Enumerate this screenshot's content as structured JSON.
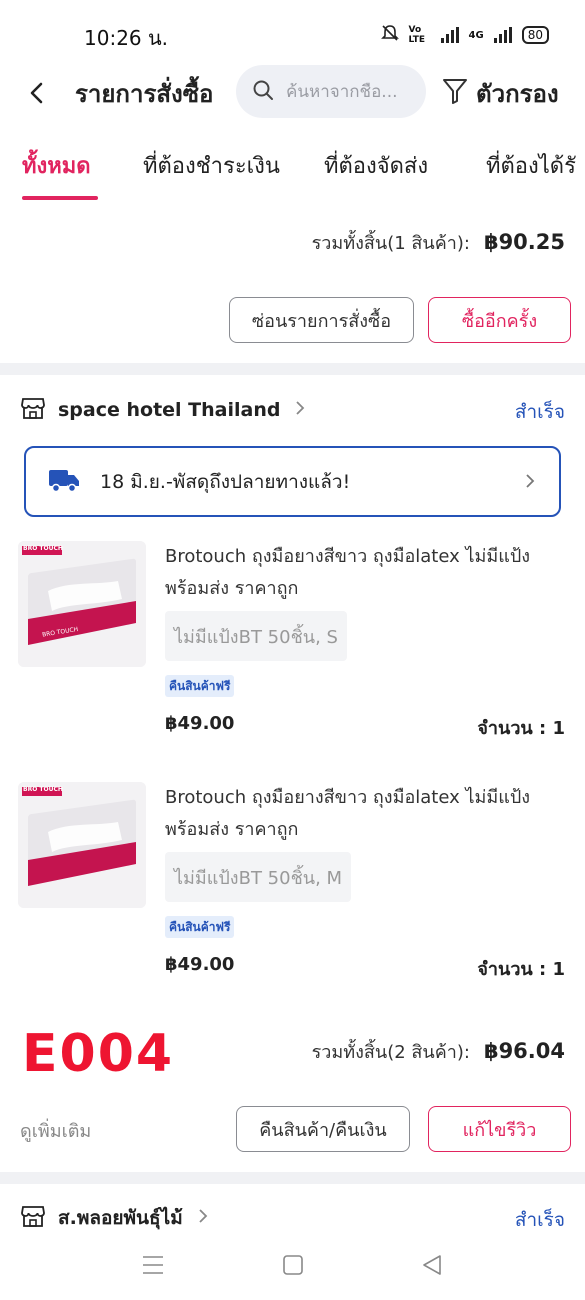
{
  "status_bar": {
    "time": "10:26 น.",
    "network": "4G",
    "volte": "Vo LTE",
    "battery": "80"
  },
  "header": {
    "title": "รายการสั่งซื้อ",
    "search_placeholder": "ค้นหาจากชื่อ...",
    "filter_label": "ตัวกรอง"
  },
  "tabs": [
    {
      "label": "ทั้งหมด",
      "active": true
    },
    {
      "label": "ที่ต้องชำระเงิน",
      "active": false
    },
    {
      "label": "ที่ต้องจัดส่ง",
      "active": false
    },
    {
      "label": "ที่ต้องได้รั",
      "active": false
    }
  ],
  "order1": {
    "total_label": "รวมทั้งสิ้น(1 สินค้า):",
    "total_amount": "฿90.25",
    "btn_hide": "ซ่อนรายการสั่งซื้อ",
    "btn_buy_again": "ซื้ออีกครั้ง"
  },
  "order2": {
    "shop_name": "space hotel Thailand",
    "status": "สำเร็จ",
    "tracking": "18 มิ.ย.-พัสดุถึงปลายทางแล้ว!",
    "products": [
      {
        "name": "Brotouch ถุงมือยางสีขาว ถุงมือlatex ไม่มีแป้ง พร้อมส่ง ราคาถูก",
        "variant": "ไม่มีแป้งBT 50ชิ้น, S",
        "badge": "คืนสินค้าฟรี",
        "price": "฿49.00",
        "quantity": "จำนวน : 1",
        "thumb_brand": "BRO TOUCH"
      },
      {
        "name": "Brotouch ถุงมือยางสีขาว ถุงมือlatex ไม่มีแป้ง พร้อมส่ง ราคาถูก",
        "variant": "ไม่มีแป้งBT 50ชิ้น, M",
        "badge": "คืนสินค้าฟรี",
        "price": "฿49.00",
        "quantity": "จำนวน : 1",
        "thumb_brand": "BRO TOUCH"
      }
    ],
    "order_code": "E004",
    "total_label": "รวมทั้งสิ้น(2 สินค้า):",
    "total_amount": "฿96.04",
    "see_more": "ดูเพิ่มเติม",
    "btn_refund": "คืนสินค้า/คืนเงิน",
    "btn_edit_review": "แก้ไขรีวิว"
  },
  "order3": {
    "shop_name": "ส.พลอยพันธุ์ไม้",
    "status": "สำเร็จ"
  },
  "colors": {
    "accent": "#e1245f",
    "link_blue": "#2553b8",
    "code_red": "#ee1531"
  }
}
